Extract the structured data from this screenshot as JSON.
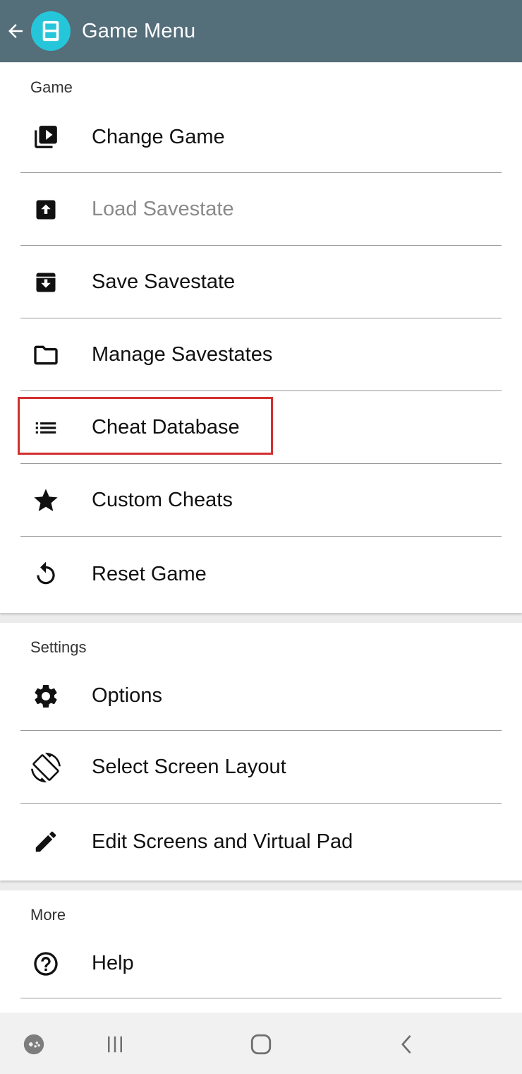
{
  "header": {
    "title": "Game Menu",
    "back_icon": "arrow-back-icon",
    "logo_icon": "nds-logo-icon"
  },
  "sections": {
    "game": {
      "title": "Game",
      "items": [
        {
          "label": "Change Game",
          "icon": "video-library-icon",
          "enabled": true
        },
        {
          "label": "Load Savestate",
          "icon": "archive-upload-icon",
          "enabled": false
        },
        {
          "label": "Save Savestate",
          "icon": "archive-download-icon",
          "enabled": true
        },
        {
          "label": "Manage Savestates",
          "icon": "folder-icon",
          "enabled": true
        },
        {
          "label": "Cheat Database",
          "icon": "list-icon",
          "enabled": true,
          "highlighted": true
        },
        {
          "label": "Custom Cheats",
          "icon": "star-icon",
          "enabled": true
        },
        {
          "label": "Reset Game",
          "icon": "reset-icon",
          "enabled": true
        }
      ]
    },
    "settings": {
      "title": "Settings",
      "items": [
        {
          "label": "Options",
          "icon": "gear-icon"
        },
        {
          "label": "Select Screen Layout",
          "icon": "screen-rotation-icon"
        },
        {
          "label": "Edit Screens and Virtual Pad",
          "icon": "pencil-icon"
        }
      ]
    },
    "more": {
      "title": "More",
      "items": [
        {
          "label": "Help",
          "icon": "help-icon"
        }
      ]
    }
  },
  "navbar": {
    "buttons": [
      "game-launcher-icon",
      "recents-icon",
      "home-icon",
      "back-icon"
    ]
  },
  "colors": {
    "appbar": "#546e7a",
    "logo": "#26c6da",
    "highlight": "#d32f2f",
    "disabled_text": "#8a8a8a"
  }
}
